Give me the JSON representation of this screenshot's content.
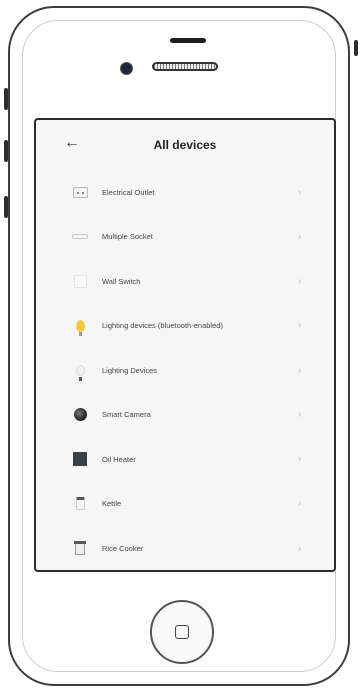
{
  "header": {
    "title": "All devices",
    "back_icon": "back-arrow-icon"
  },
  "devices": [
    {
      "label": "Electrical Outlet",
      "icon": "outlet-icon"
    },
    {
      "label": "Multiple Socket",
      "icon": "power-strip-icon"
    },
    {
      "label": "Wall Switch",
      "icon": "wall-switch-icon"
    },
    {
      "label": "Lighting devices (bluetooth-enabled)",
      "icon": "bluetooth-bulb-icon"
    },
    {
      "label": "Lighting Devices",
      "icon": "light-bulb-icon"
    },
    {
      "label": "Smart Camera",
      "icon": "camera-icon"
    },
    {
      "label": "Oil Heater",
      "icon": "heater-icon"
    },
    {
      "label": "Kettle",
      "icon": "kettle-icon"
    },
    {
      "label": "Rice Cooker",
      "icon": "rice-cooker-icon"
    }
  ],
  "chevron_icon": "chevron-right-icon",
  "device": {
    "home_button_icon": "home-square-icon"
  },
  "colors": {
    "bulb_yellow": "#f5c84a",
    "screen_bg": "#f6f6f6",
    "frame": "#3d3d3d"
  }
}
